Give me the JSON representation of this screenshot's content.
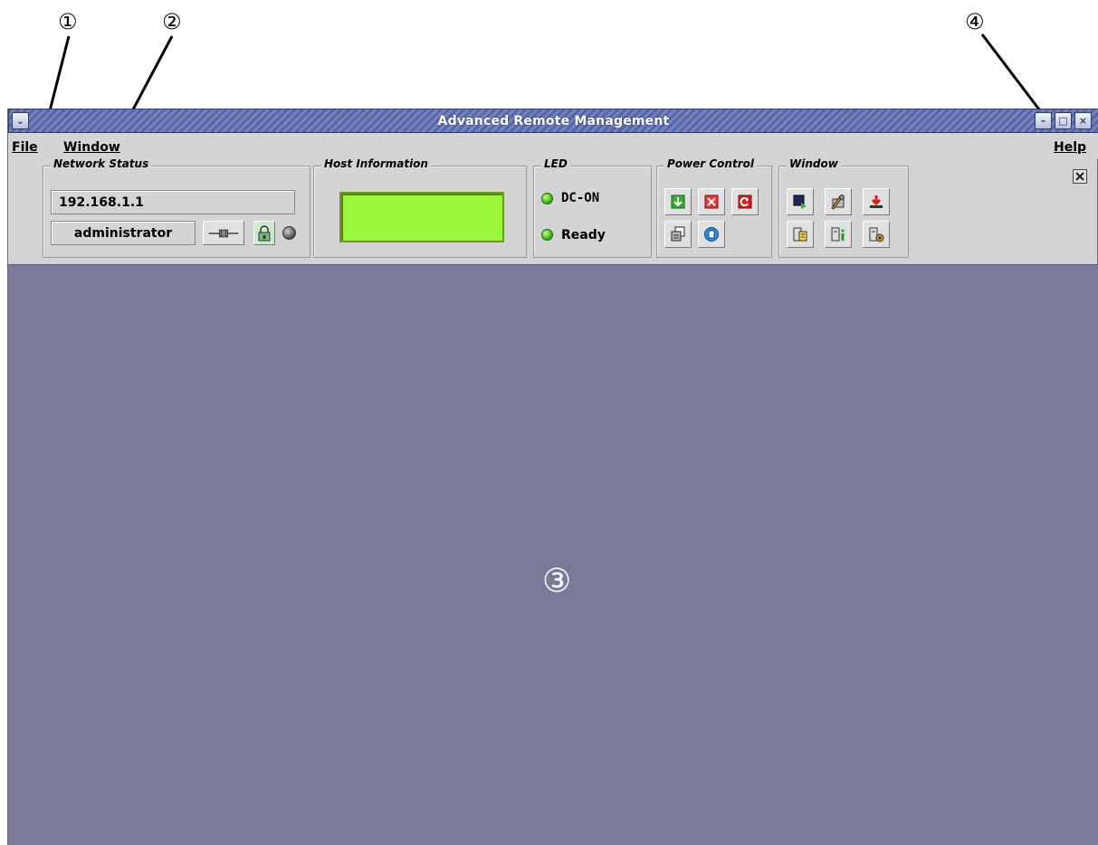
{
  "annotations": {
    "callout_1": "①",
    "callout_2": "②",
    "callout_3": "③",
    "callout_4": "④"
  },
  "window": {
    "title": "Advanced Remote Management",
    "menu": {
      "file": "File",
      "window": "Window",
      "help": "Help"
    }
  },
  "network_status": {
    "label": "Network Status",
    "ip_address": "192.168.1.1",
    "user": "administrator"
  },
  "host_information": {
    "label": "Host Information"
  },
  "led": {
    "label": "LED",
    "items": [
      {
        "text": "DC-ON",
        "color": "#48c01e"
      },
      {
        "text": "Ready",
        "color": "#48c01e"
      }
    ]
  },
  "power_control": {
    "label": "Power Control",
    "buttons": [
      "power-on-icon",
      "power-off-icon",
      "reset-icon",
      "nmi-icon",
      "remote-batch-icon"
    ]
  },
  "window_group": {
    "label": "Window",
    "buttons": [
      "remote-console-icon",
      "maintenance-tools-icon",
      "install-icon",
      "event-log-icon",
      "server-info-icon",
      "server-settings-icon"
    ]
  },
  "colors": {
    "title_bar": "#5767a4",
    "lcd_panel": "#9bf53a",
    "main_area": "#7a799a"
  }
}
